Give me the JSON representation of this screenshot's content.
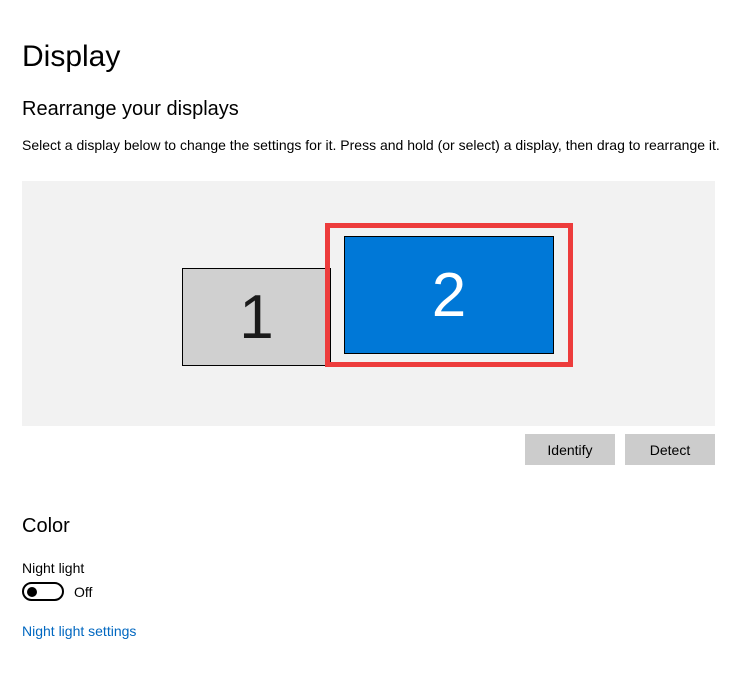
{
  "page": {
    "title": "Display"
  },
  "rearrange": {
    "title": "Rearrange your displays",
    "help": "Select a display below to change the settings for it. Press and hold (or select) a display, then drag to rearrange it.",
    "monitors": {
      "m1": "1",
      "m2": "2"
    },
    "identify_label": "Identify",
    "detect_label": "Detect"
  },
  "color": {
    "title": "Color",
    "night_light_label": "Night light",
    "toggle_state": "Off",
    "settings_link": "Night light settings"
  }
}
